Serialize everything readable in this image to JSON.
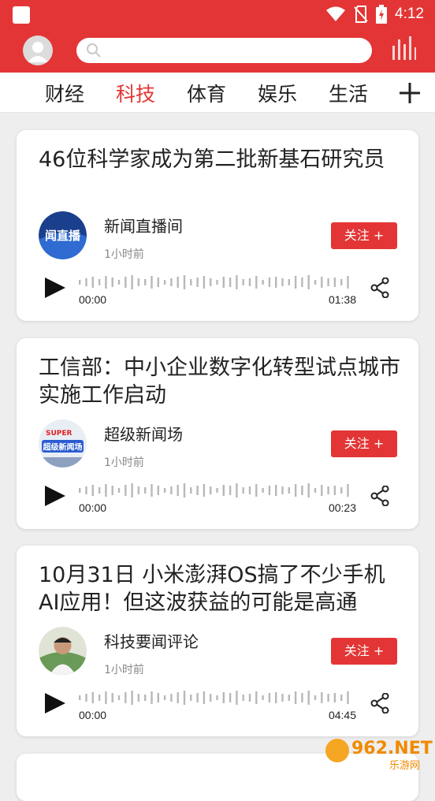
{
  "status": {
    "time": "4:12"
  },
  "tabs": [
    {
      "label": "财经",
      "active": false
    },
    {
      "label": "科技",
      "active": true
    },
    {
      "label": "体育",
      "active": false
    },
    {
      "label": "娱乐",
      "active": false
    },
    {
      "label": "生活",
      "active": false
    }
  ],
  "colors": {
    "brand": "#e33535",
    "text": "#222222",
    "muted": "#888888"
  },
  "cards": [
    {
      "title": "46位科学家成为第二批新基石研究员",
      "channel": "新闻直播间",
      "time": "1小时前",
      "follow": "关注 +",
      "start": "00:00",
      "end": "01:38"
    },
    {
      "title": "工信部：中小企业数字化转型试点城市实施工作启动",
      "channel": "超级新闻场",
      "time": "1小时前",
      "follow": "关注 +",
      "start": "00:00",
      "end": "00:23"
    },
    {
      "title": "10月31日 小米澎湃OS搞了不少手机AI应用！但这波获益的可能是高通",
      "channel": "科技要闻评论",
      "time": "1小时前",
      "follow": "关注 +",
      "start": "00:00",
      "end": "04:45"
    }
  ],
  "avatar_texts": {
    "card1": "闻直播",
    "card2_top": "SUPER",
    "card2_bottom": "超级新闻场"
  },
  "watermark": {
    "brand": "962.NET",
    "sub": "乐游网"
  }
}
